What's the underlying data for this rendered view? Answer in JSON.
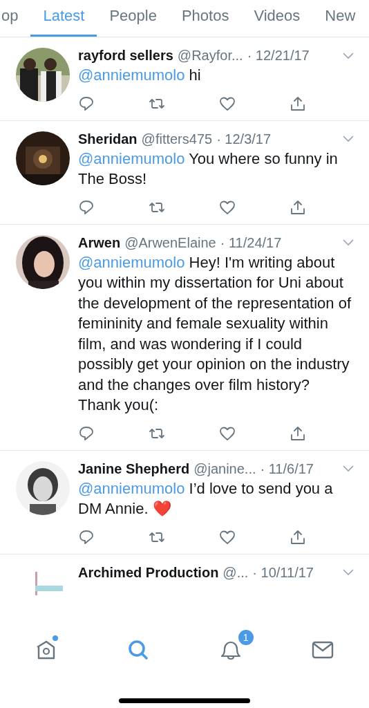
{
  "tabs": [
    {
      "label": "op",
      "selected": false
    },
    {
      "label": "Latest",
      "selected": true
    },
    {
      "label": "People",
      "selected": false
    },
    {
      "label": "Photos",
      "selected": false
    },
    {
      "label": "Videos",
      "selected": false
    },
    {
      "label": "New",
      "selected": false
    }
  ],
  "tweets": [
    {
      "name": "rayford sellers",
      "handle": "@Rayfor...",
      "date": "· 12/21/17",
      "mention": "@anniemumolo",
      "text": "hi"
    },
    {
      "name": "Sheridan",
      "handle": "@fitters475",
      "date": "· 12/3/17",
      "mention": "@anniemumolo",
      "text": "You where so funny in The Boss!"
    },
    {
      "name": "Arwen",
      "handle": "@ArwenElaine",
      "date": "· 11/24/17",
      "mention": "@anniemumolo",
      "text": "Hey! I'm writing about you within my dissertation for Uni about the development of the representation of femininity and female sexuality within film, and was wondering if I could possibly get your opinion on the industry and the changes over film history? Thank you(:"
    },
    {
      "name": "Janine Shepherd",
      "handle": "@janine...",
      "date": "· 11/6/17",
      "mention": "@anniemumolo",
      "text": "I’d love to send you a DM Annie.",
      "emoji": "❤️"
    },
    {
      "name": "Archimed Production",
      "handle": "@...",
      "date": "· 10/11/17"
    }
  ],
  "nav": [
    {
      "kind": "home",
      "selected": false,
      "dot": true
    },
    {
      "kind": "search",
      "selected": true
    },
    {
      "kind": "bell",
      "selected": false,
      "badge": "1"
    },
    {
      "kind": "mail",
      "selected": false
    }
  ]
}
